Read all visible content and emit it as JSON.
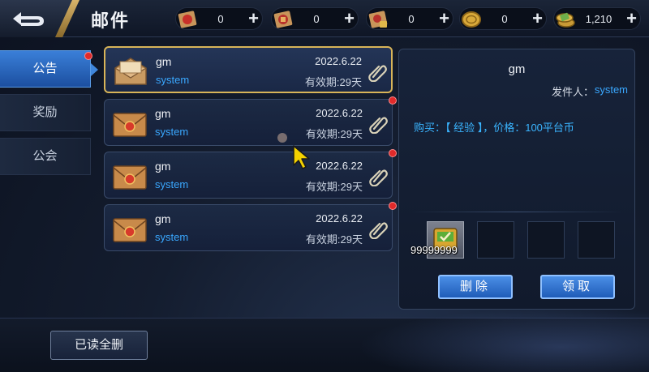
{
  "header": {
    "title": "邮件",
    "resources": [
      {
        "icon": "red-ticket-icon",
        "value": "0"
      },
      {
        "icon": "scroll-ticket-icon",
        "value": "0"
      },
      {
        "icon": "locked-ticket-icon",
        "value": "0"
      },
      {
        "icon": "gold-coin-icon",
        "value": "0"
      },
      {
        "icon": "coin-stack-icon",
        "value": "1,210"
      }
    ],
    "plus": "+"
  },
  "tabs": [
    {
      "label": "公告",
      "active": true,
      "badge": true
    },
    {
      "label": "奖励",
      "active": false,
      "badge": false
    },
    {
      "label": "公会",
      "active": false,
      "badge": false
    }
  ],
  "mails": [
    {
      "sender": "gm",
      "source": "system",
      "date": "2022.6.22",
      "expiry": "有效期:29天",
      "selected": true,
      "unread": false
    },
    {
      "sender": "gm",
      "source": "system",
      "date": "2022.6.22",
      "expiry": "有效期:29天",
      "selected": false,
      "unread": true
    },
    {
      "sender": "gm",
      "source": "system",
      "date": "2022.6.22",
      "expiry": "有效期:29天",
      "selected": false,
      "unread": true
    },
    {
      "sender": "gm",
      "source": "system",
      "date": "2022.6.22",
      "expiry": "有效期:29天",
      "selected": false,
      "unread": true
    }
  ],
  "detail": {
    "title": "gm",
    "sender_label": "发件人：",
    "sender_value": "system",
    "body": "购买：【 经验 】，价格：100平台币",
    "attachment_qty": "99999999",
    "delete_label": "删除",
    "claim_label": "领取"
  },
  "footer": {
    "read_all_label": "已读全删"
  },
  "colors": {
    "accent_blue": "#3aa8ff",
    "tab_active": "#2a66c0",
    "selected_border": "#d8b458",
    "badge_red": "#e02a2a"
  }
}
